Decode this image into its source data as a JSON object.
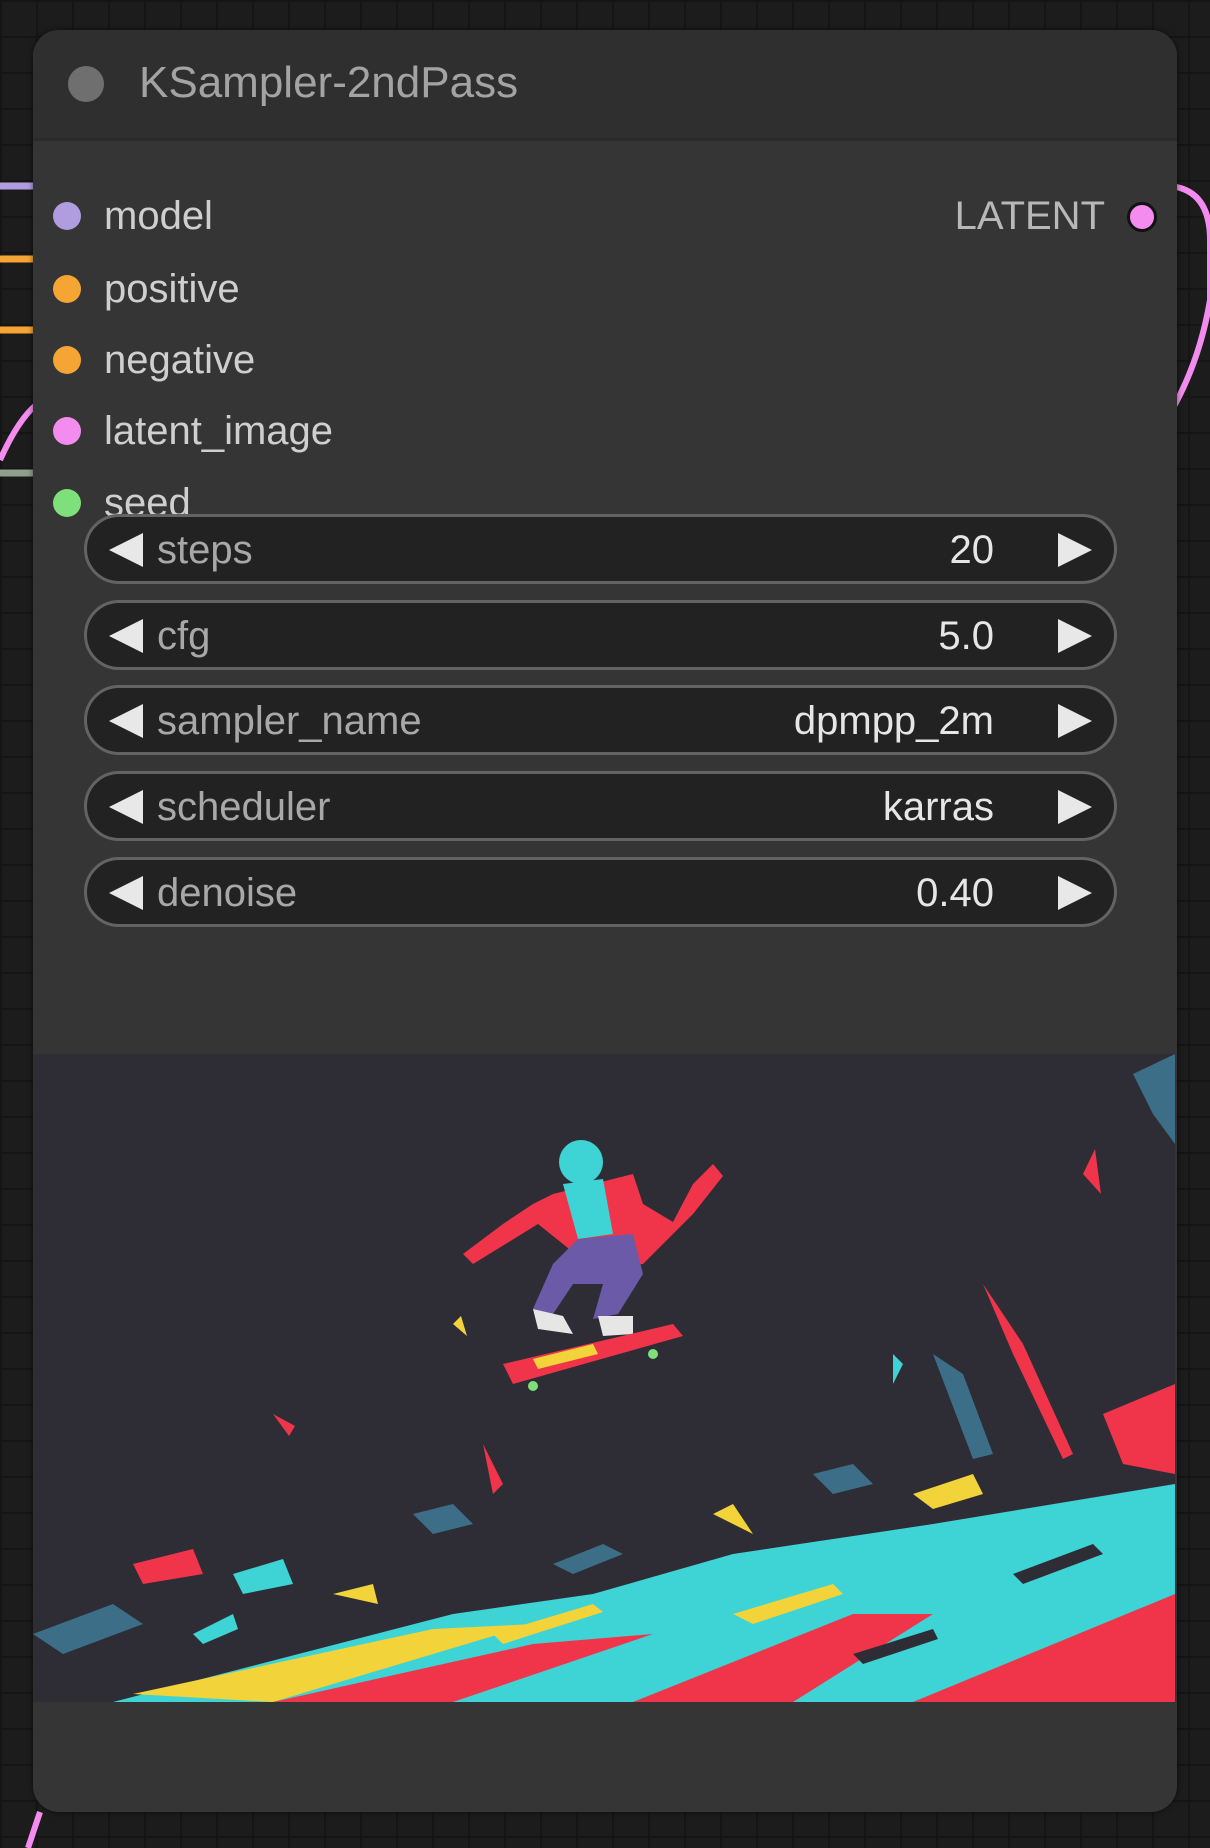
{
  "node": {
    "title": "KSampler-2ndPass"
  },
  "inputs": [
    {
      "label": "model",
      "color": "#b09de0"
    },
    {
      "label": "positive",
      "color": "#f5a533"
    },
    {
      "label": "negative",
      "color": "#f5a533"
    },
    {
      "label": "latent_image",
      "color": "#f48cf0"
    },
    {
      "label": "seed",
      "color": "#7ee07a"
    }
  ],
  "outputs": [
    {
      "label": "LATENT",
      "color": "#f48cf0"
    }
  ],
  "widgets": [
    {
      "label": "steps",
      "value": "20"
    },
    {
      "label": "cfg",
      "value": "5.0"
    },
    {
      "label": "sampler_name",
      "value": "dpmpp_2m"
    },
    {
      "label": "scheduler",
      "value": "karras"
    },
    {
      "label": "denoise",
      "value": "0.40"
    }
  ],
  "preview": {
    "icon": "skateboarder-preview-image",
    "palette": [
      "#2e2d36",
      "#3ed3d4",
      "#f0354a",
      "#f2d33a"
    ]
  }
}
